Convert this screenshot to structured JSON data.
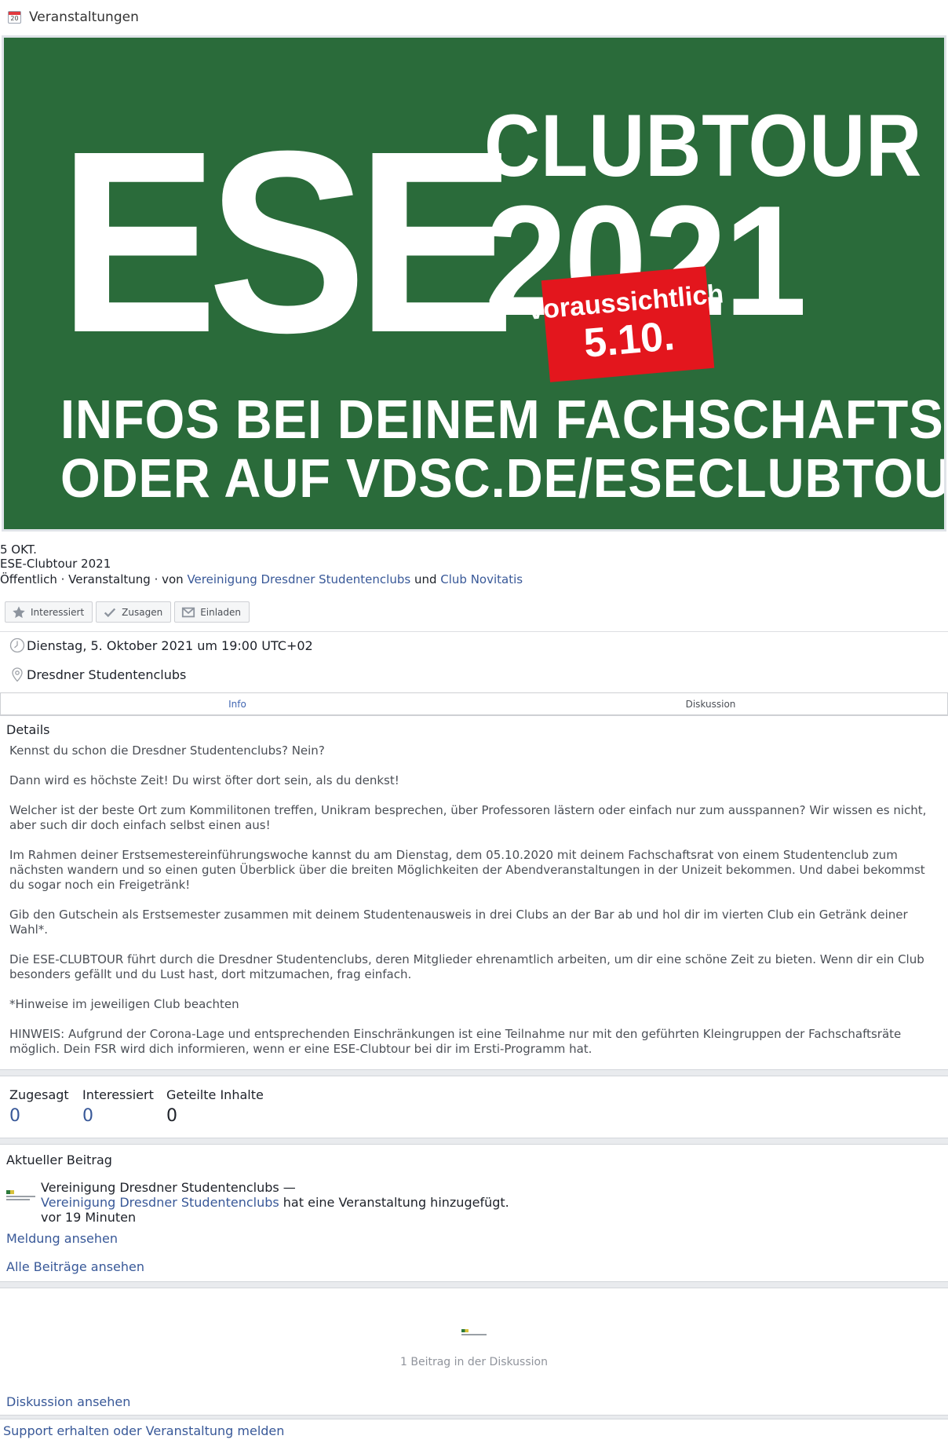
{
  "header": {
    "calendar_day": "20",
    "title": "Veranstaltungen"
  },
  "banner": {
    "big_text": "ESE",
    "clubtour": "CLUBTOUR",
    "year": "2021",
    "stamp_line1": "voraussichtlich",
    "stamp_line2": "5.10.",
    "line1": "INFOS BEI DEINEM FACHSCHAFTSRAT",
    "line2": "ODER AUF VDSC.DE/ESECLUBTOUR",
    "bg_color": "#2a6b3a",
    "stamp_color": "#e3161d"
  },
  "event": {
    "date": "5 OKT.",
    "title": "ESE-Clubtour 2021",
    "meta_prefix": "Öffentlich · Veranstaltung · von ",
    "host1": "Vereinigung Dresdner Studentenclubs",
    "meta_and": " und ",
    "host2": "Club Novitatis"
  },
  "actions": {
    "interested": "Interessiert",
    "going": "Zusagen",
    "invite": "Einladen"
  },
  "info": {
    "datetime": "Dienstag, 5. Oktober 2021 um 19:00 UTC+02",
    "location": "Dresdner Studentenclubs"
  },
  "tabs": {
    "info": "Info",
    "discussion": "Diskussion"
  },
  "details": {
    "heading": "Details",
    "paragraphs": [
      "Kennst du schon die Dresdner Studentenclubs? Nein?",
      "Dann wird es höchste Zeit! Du wirst öfter dort sein, als du denkst!",
      "Welcher ist der beste Ort zum Kommilitonen treffen, Unikram besprechen, über Professoren lästern oder einfach nur zum ausspannen? Wir wissen es nicht, aber such dir doch einfach selbst einen aus!",
      "Im Rahmen deiner Erstsemestereinführungswoche kannst du am Dienstag, dem 05.10.2020 mit deinem Fachschaftsrat von einem Studentenclub zum nächsten wandern und so einen guten Überblick über die breiten Möglichkeiten der Abendveranstaltungen in der Unizeit bekommen. Und dabei bekommst du sogar noch ein Freigetränk!",
      "Gib den Gutschein als Erstsemester zusammen mit deinem Studentenausweis in drei Clubs an der Bar ab und hol dir im vierten Club ein Getränk deiner Wahl*.",
      "Die ESE-CLUBTOUR führt durch die Dresdner Studentenclubs, deren Mitglieder ehrenamtlich arbeiten, um dir eine schöne Zeit zu bieten. Wenn dir ein Club besonders gefällt und du Lust hast, dort mitzumachen, frag einfach.",
      "*Hinweise im jeweiligen Club beachten",
      "HINWEIS: Aufgrund der Corona-Lage und entsprechenden Einschränkungen ist eine Teilnahme nur mit den geführten Kleingruppen der Fachschaftsräte möglich. Dein FSR wird dich informieren, wenn er eine ESE-Clubtour bei dir im Ersti-Programm hat."
    ]
  },
  "stats": {
    "going_label": "Zugesagt",
    "going_value": "0",
    "interested_label": "Interessiert",
    "interested_value": "0",
    "shared_label": "Geteilte Inhalte",
    "shared_value": "0"
  },
  "recent": {
    "heading": "Aktueller Beitrag",
    "author": "Vereinigung Dresdner Studentenclubs —",
    "author_link": "Vereinigung Dresdner Studentenclubs",
    "action": " hat eine Veranstaltung hinzugefügt.",
    "time": "vor 19 Minuten",
    "view_post": "Meldung ansehen",
    "view_all": "Alle Beiträge ansehen"
  },
  "discussion": {
    "count_text": "1 Beitrag in der Diskussion",
    "view": "Diskussion ansehen"
  },
  "footer": {
    "support": "Support erhalten oder Veranstaltung melden"
  },
  "colors": {
    "link": "#385898",
    "active_tab": "#4267b2",
    "muted": "#4b4f56"
  }
}
